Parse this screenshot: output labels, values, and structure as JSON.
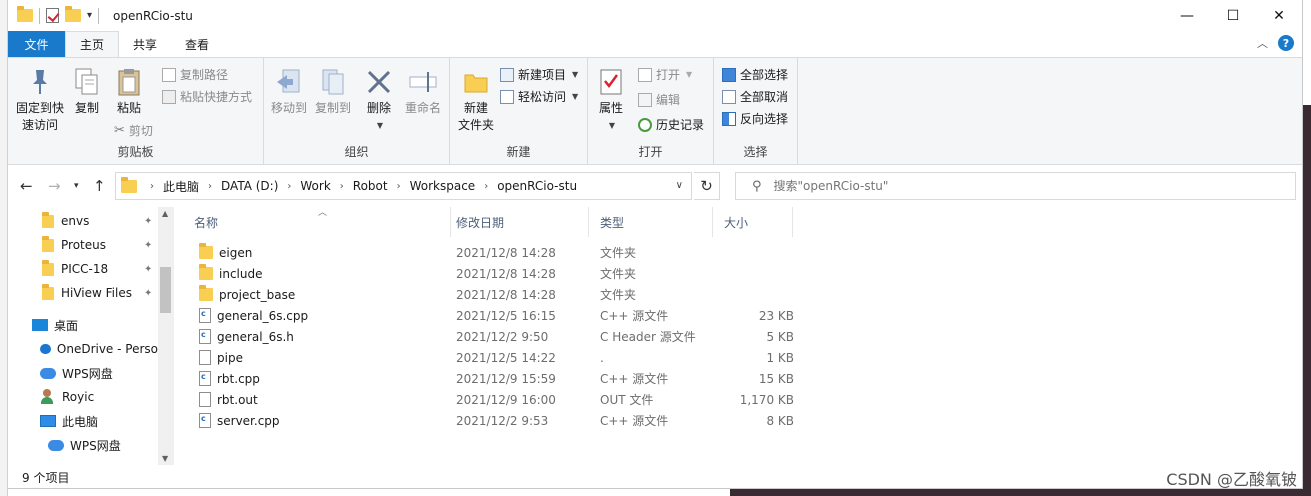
{
  "window": {
    "title": "openRCio-stu",
    "controls": {
      "minimize": "—",
      "maximize": "☐",
      "close": "✕"
    }
  },
  "tabs": [
    {
      "label": "文件"
    },
    {
      "label": "主页"
    },
    {
      "label": "共享"
    },
    {
      "label": "查看"
    }
  ],
  "ribbon": {
    "clipboard": {
      "label": "剪贴板",
      "pin": "固定到快\n速访问",
      "copy": "复制",
      "paste": "粘贴",
      "copy_path": "复制路径",
      "paste_shortcut": "粘贴快捷方式",
      "cut": "剪切"
    },
    "organize": {
      "label": "组织",
      "move_to": "移动到",
      "copy_to": "复制到",
      "delete": "删除",
      "rename": "重命名"
    },
    "new": {
      "label": "新建",
      "new_folder": "新建\n文件夹",
      "new_item": "新建项目",
      "easy_access": "轻松访问"
    },
    "open": {
      "label": "打开",
      "properties": "属性",
      "open": "打开",
      "edit": "编辑",
      "history": "历史记录"
    },
    "select": {
      "label": "选择",
      "select_all": "全部选择",
      "select_none": "全部取消",
      "invert": "反向选择"
    }
  },
  "address": {
    "breadcrumb": [
      "此电脑",
      "DATA (D:)",
      "Work",
      "Robot",
      "Workspace",
      "openRCio-stu"
    ],
    "search_placeholder": "搜索\"openRCio-stu\""
  },
  "nav": {
    "quick_access": [
      {
        "label": "envs"
      },
      {
        "label": "Proteus"
      },
      {
        "label": "PICC-18"
      },
      {
        "label": "HiView Files"
      }
    ],
    "desktop": "桌面",
    "onedrive": "OneDrive - Perso",
    "wps_drive": "WPS网盘",
    "user": "Royic",
    "this_pc": "此电脑",
    "wps_drive_2": "WPS网盘"
  },
  "columns": {
    "name": "名称",
    "date": "修改日期",
    "type": "类型",
    "size": "大小"
  },
  "files": [
    {
      "name": "eigen",
      "date": "2021/12/8 14:28",
      "type": "文件夹",
      "size": "",
      "icon": "folder-icon"
    },
    {
      "name": "include",
      "date": "2021/12/8 14:28",
      "type": "文件夹",
      "size": "",
      "icon": "folder-icon"
    },
    {
      "name": "project_base",
      "date": "2021/12/8 14:28",
      "type": "文件夹",
      "size": "",
      "icon": "folder-icon"
    },
    {
      "name": "general_6s.cpp",
      "date": "2021/12/5 16:15",
      "type": "C++ 源文件",
      "size": "23 KB",
      "icon": "cpp-file-icon"
    },
    {
      "name": "general_6s.h",
      "date": "2021/12/2 9:50",
      "type": "C Header 源文件",
      "size": "5 KB",
      "icon": "header-file-icon"
    },
    {
      "name": "pipe",
      "date": "2021/12/5 14:22",
      "type": ".",
      "size": "1 KB",
      "icon": "file-icon"
    },
    {
      "name": "rbt.cpp",
      "date": "2021/12/9 15:59",
      "type": "C++ 源文件",
      "size": "15 KB",
      "icon": "cpp-file-icon"
    },
    {
      "name": "rbt.out",
      "date": "2021/12/9 16:00",
      "type": "OUT 文件",
      "size": "1,170 KB",
      "icon": "file-icon"
    },
    {
      "name": "server.cpp",
      "date": "2021/12/2 9:53",
      "type": "C++ 源文件",
      "size": "8 KB",
      "icon": "cpp-file-icon"
    }
  ],
  "status": {
    "count": "9 个项目"
  },
  "watermark": "CSDN @乙酸氧铍",
  "colors": {
    "accent": "#1979ca",
    "folder": "#f8cf53",
    "ribbon_bg": "#f5f6f7"
  }
}
